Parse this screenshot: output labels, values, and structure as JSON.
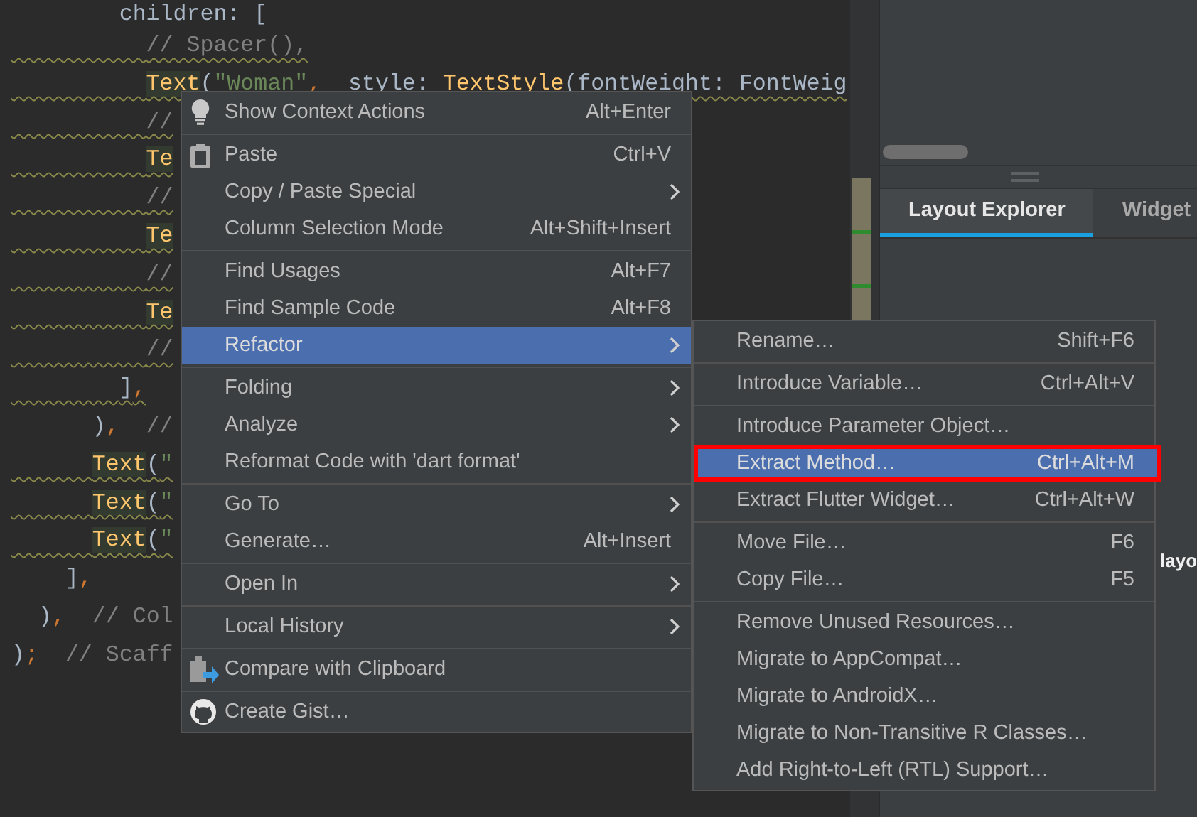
{
  "editor": {
    "lines": [
      {
        "warning": false,
        "tokens": [
          {
            "kind": "plain",
            "text": "        children: ["
          }
        ]
      },
      {
        "warning": true,
        "tokens": [
          {
            "kind": "comment",
            "text": "          // Spacer(),"
          }
        ]
      },
      {
        "warning": true,
        "tokens": [
          {
            "kind": "widget",
            "text": "          Text"
          },
          {
            "kind": "plain",
            "text": "("
          },
          {
            "kind": "string",
            "text": "\"Woman\""
          },
          {
            "kind": "punct",
            "text": ","
          },
          {
            "kind": "plain",
            "text": "  style: "
          },
          {
            "kind": "type",
            "text": "TextStyle"
          },
          {
            "kind": "plain",
            "text": "(fontWeight: FontWeig"
          }
        ]
      },
      {
        "warning": true,
        "tokens": [
          {
            "kind": "comment",
            "text": "          //"
          }
        ]
      },
      {
        "warning": true,
        "tokens": [
          {
            "kind": "widget",
            "text": "          Te"
          }
        ]
      },
      {
        "warning": true,
        "tokens": [
          {
            "kind": "comment",
            "text": "          //"
          }
        ]
      },
      {
        "warning": true,
        "tokens": [
          {
            "kind": "widget",
            "text": "          Te"
          }
        ]
      },
      {
        "warning": true,
        "tokens": [
          {
            "kind": "comment",
            "text": "          //"
          }
        ]
      },
      {
        "warning": true,
        "tokens": [
          {
            "kind": "widget",
            "text": "          Te"
          }
        ]
      },
      {
        "warning": true,
        "tokens": [
          {
            "kind": "comment",
            "text": "          //"
          }
        ]
      },
      {
        "warning": true,
        "tokens": [
          {
            "kind": "plain",
            "text": "        ]"
          },
          {
            "kind": "punct",
            "text": ","
          }
        ]
      },
      {
        "warning": false,
        "tokens": [
          {
            "kind": "plain",
            "text": "      )"
          },
          {
            "kind": "punct",
            "text": ","
          },
          {
            "kind": "comment",
            "text": "  //"
          }
        ]
      },
      {
        "warning": true,
        "tokens": [
          {
            "kind": "widget",
            "text": "      Text"
          },
          {
            "kind": "plain",
            "text": "("
          },
          {
            "kind": "string",
            "text": "\""
          }
        ]
      },
      {
        "warning": true,
        "tokens": [
          {
            "kind": "widget",
            "text": "      Text"
          },
          {
            "kind": "plain",
            "text": "("
          },
          {
            "kind": "string",
            "text": "\""
          }
        ]
      },
      {
        "warning": true,
        "tokens": [
          {
            "kind": "widget",
            "text": "      Text"
          },
          {
            "kind": "plain",
            "text": "("
          },
          {
            "kind": "string",
            "text": "\""
          }
        ]
      },
      {
        "warning": false,
        "tokens": [
          {
            "kind": "plain",
            "text": "    ]"
          },
          {
            "kind": "punct",
            "text": ","
          }
        ]
      },
      {
        "warning": false,
        "tokens": [
          {
            "kind": "plain",
            "text": "  )"
          },
          {
            "kind": "punct",
            "text": ","
          },
          {
            "kind": "comment",
            "text": "  // Col"
          }
        ]
      },
      {
        "warning": false,
        "tokens": [
          {
            "kind": "plain",
            "text": ")"
          },
          {
            "kind": "punct",
            "text": ";"
          },
          {
            "kind": "comment",
            "text": "  // Scaff"
          }
        ]
      }
    ]
  },
  "context_menu": {
    "groups": [
      {
        "items": [
          {
            "kind": "bulb",
            "label": "Show Context Actions",
            "shortcut": "Alt+Enter",
            "submenu": false,
            "selected": false
          }
        ]
      },
      {
        "items": [
          {
            "kind": "clipboard",
            "label": "Paste",
            "shortcut": "Ctrl+V",
            "submenu": false,
            "selected": false
          },
          {
            "label": "Copy / Paste Special",
            "submenu": true,
            "selected": false
          },
          {
            "label": "Column Selection Mode",
            "shortcut": "Alt+Shift+Insert",
            "submenu": false,
            "selected": false
          }
        ]
      },
      {
        "items": [
          {
            "label": "Find Usages",
            "shortcut": "Alt+F7",
            "submenu": false,
            "selected": false
          },
          {
            "label": "Find Sample Code",
            "shortcut": "Alt+F8",
            "submenu": false,
            "selected": false
          },
          {
            "label": "Refactor",
            "submenu": true,
            "selected": true
          }
        ]
      },
      {
        "items": [
          {
            "label": "Folding",
            "submenu": true,
            "selected": false
          },
          {
            "label": "Analyze",
            "submenu": true,
            "selected": false
          },
          {
            "label": "Reformat Code with 'dart format'",
            "submenu": false,
            "selected": false
          }
        ]
      },
      {
        "items": [
          {
            "label": "Go To",
            "submenu": true,
            "selected": false
          },
          {
            "label": "Generate…",
            "shortcut": "Alt+Insert",
            "submenu": false,
            "selected": false
          }
        ]
      },
      {
        "items": [
          {
            "label": "Open In",
            "submenu": true,
            "selected": false
          }
        ]
      },
      {
        "items": [
          {
            "label": "Local History",
            "submenu": true,
            "selected": false
          }
        ]
      },
      {
        "items": [
          {
            "kind": "compare",
            "label": "Compare with Clipboard",
            "submenu": false,
            "selected": false
          }
        ]
      },
      {
        "items": [
          {
            "kind": "gist",
            "label": "Create Gist…",
            "submenu": false,
            "selected": false
          }
        ]
      }
    ]
  },
  "refactor_submenu": {
    "groups": [
      {
        "items": [
          {
            "label": "Rename…",
            "shortcut": "Shift+F6",
            "selected": false,
            "outlined": false
          }
        ]
      },
      {
        "items": [
          {
            "label": "Introduce Variable…",
            "shortcut": "Ctrl+Alt+V",
            "selected": false,
            "outlined": false
          }
        ]
      },
      {
        "items": [
          {
            "label": "Introduce Parameter Object…",
            "selected": false,
            "outlined": false
          },
          {
            "label": "Extract Method…",
            "shortcut": "Ctrl+Alt+M",
            "selected": true,
            "outlined": true
          },
          {
            "label": "Extract Flutter Widget…",
            "shortcut": "Ctrl+Alt+W",
            "selected": false,
            "outlined": false
          }
        ]
      },
      {
        "items": [
          {
            "label": "Move File…",
            "shortcut": "F6",
            "selected": false,
            "outlined": false
          },
          {
            "label": "Copy File…",
            "shortcut": "F5",
            "selected": false,
            "outlined": false
          }
        ]
      },
      {
        "items": [
          {
            "label": "Remove Unused Resources…",
            "selected": false,
            "outlined": false
          },
          {
            "label": "Migrate to AppCompat…",
            "selected": false,
            "outlined": false
          },
          {
            "label": "Migrate to AndroidX…",
            "selected": false,
            "outlined": false
          },
          {
            "label": "Migrate to Non-Transitive R Classes…",
            "selected": false,
            "outlined": false
          },
          {
            "label": "Add Right-to-Left (RTL) Support…",
            "selected": false,
            "outlined": false
          }
        ]
      }
    ]
  },
  "panel": {
    "tabs": [
      {
        "label": "Layout Explorer",
        "selected": true
      },
      {
        "label": "Widget",
        "selected": false
      }
    ],
    "body_text": "layo"
  }
}
